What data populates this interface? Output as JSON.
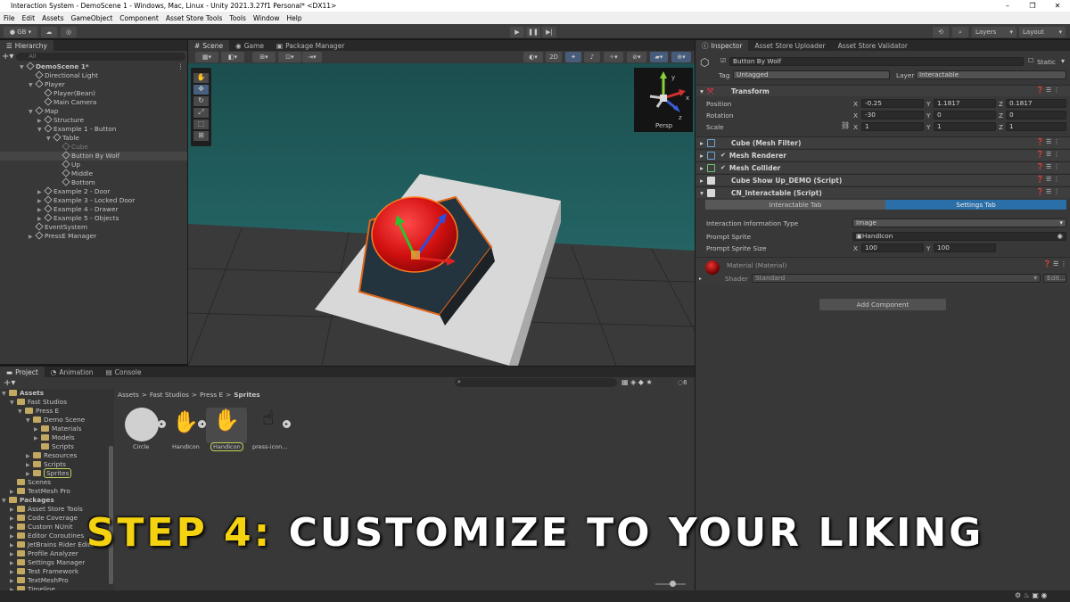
{
  "window": {
    "title": "Interaction System - DemoScene 1 - Windows, Mac, Linux - Unity 2021.3.27f1 Personal* <DX11>"
  },
  "menu": [
    "File",
    "Edit",
    "Assets",
    "GameObject",
    "Component",
    "Asset Store Tools",
    "Tools",
    "Window",
    "Help"
  ],
  "toolbar": {
    "account": "GB",
    "layers": "Layers",
    "layout": "Layout"
  },
  "hierarchy": {
    "tab": "Hierarchy",
    "search_placeholder": "All",
    "items": [
      {
        "label": "DemoScene 1*",
        "depth": 0
      },
      {
        "label": "Directional Light",
        "depth": 1
      },
      {
        "label": "Player",
        "depth": 1
      },
      {
        "label": "Player(Bean)",
        "depth": 2
      },
      {
        "label": "Main Camera",
        "depth": 2
      },
      {
        "label": "Map",
        "depth": 1
      },
      {
        "label": "Structure",
        "depth": 2
      },
      {
        "label": "Example 1 - Button",
        "depth": 2
      },
      {
        "label": "Table",
        "depth": 3
      },
      {
        "label": "Cube",
        "depth": 4
      },
      {
        "label": "Button By Wolf",
        "depth": 4
      },
      {
        "label": "Up",
        "depth": 4
      },
      {
        "label": "Middle",
        "depth": 4
      },
      {
        "label": "Bottom",
        "depth": 4
      },
      {
        "label": "Example 2 - Door",
        "depth": 2
      },
      {
        "label": "Example 3 - Locked Door",
        "depth": 2
      },
      {
        "label": "Example 4 - Drawer",
        "depth": 2
      },
      {
        "label": "Example 5 - Objects",
        "depth": 2
      },
      {
        "label": "EventSystem",
        "depth": 1
      },
      {
        "label": "PressE Manager",
        "depth": 1
      }
    ]
  },
  "scene_tabs": [
    "Scene",
    "Game",
    "Package Manager"
  ],
  "scene": {
    "mode_2d": "2D",
    "gizmo_label": "Persp",
    "gizmo_x": "x",
    "gizmo_y": "y",
    "gizmo_z": "z"
  },
  "inspector": {
    "tabs": [
      "Inspector",
      "Asset Store Uploader",
      "Asset Store Validator"
    ],
    "object_name": "Button By Wolf",
    "static_label": "Static",
    "tag_label": "Tag",
    "tag_value": "Untagged",
    "layer_label": "Layer",
    "layer_value": "Interactable",
    "transform": {
      "title": "Transform",
      "position": {
        "label": "Position",
        "x": "-0.25",
        "y": "1.1817",
        "z": "0.1817"
      },
      "rotation": {
        "label": "Rotation",
        "x": "-30",
        "y": "0",
        "z": "0"
      },
      "scale": {
        "label": "Scale",
        "x": "1",
        "y": "1",
        "z": "1"
      },
      "axis_x": "X",
      "axis_y": "Y",
      "axis_z": "Z"
    },
    "components": [
      "Cube (Mesh Filter)",
      "Mesh Renderer",
      "Mesh Collider",
      "Cube Show Up_DEMO (Script)",
      "CN_Interactable (Script)"
    ],
    "interactable": {
      "tab_left": "Interactable Tab",
      "tab_right": "Settings Tab",
      "info_type_label": "Interaction Information Type",
      "info_type_value": "Image",
      "sprite_label": "Prompt Sprite",
      "sprite_value": "HandIcon",
      "size_label": "Prompt Sprite Size",
      "size_x": "100",
      "size_y": "100"
    },
    "material": {
      "title": "Material (Material)",
      "shader_label": "Shader",
      "shader_value": "Standard",
      "edit_label": "Edit..."
    },
    "add_component": "Add Component"
  },
  "project": {
    "tabs": [
      "Project",
      "Animation",
      "Console"
    ],
    "tree": [
      {
        "label": "Assets",
        "depth": 0,
        "bold": true
      },
      {
        "label": "Fast Studios",
        "depth": 1
      },
      {
        "label": "Press E",
        "depth": 2
      },
      {
        "label": "Demo Scene",
        "depth": 3
      },
      {
        "label": "Materials",
        "depth": 4
      },
      {
        "label": "Models",
        "depth": 4
      },
      {
        "label": "Scripts",
        "depth": 4
      },
      {
        "label": "Resources",
        "depth": 3
      },
      {
        "label": "Scripts",
        "depth": 3
      },
      {
        "label": "Sprites",
        "depth": 3
      },
      {
        "label": "Scenes",
        "depth": 1
      },
      {
        "label": "TextMesh Pro",
        "depth": 1
      },
      {
        "label": "Packages",
        "depth": 0,
        "bold": true
      },
      {
        "label": "Asset Store Tools",
        "depth": 1
      },
      {
        "label": "Code Coverage",
        "depth": 1
      },
      {
        "label": "Custom NUnit",
        "depth": 1
      },
      {
        "label": "Editor Coroutines",
        "depth": 1
      },
      {
        "label": "JetBrains Rider Editor",
        "depth": 1
      },
      {
        "label": "Profile Analyzer",
        "depth": 1
      },
      {
        "label": "Settings Manager",
        "depth": 1
      },
      {
        "label": "Test Framework",
        "depth": 1
      },
      {
        "label": "TextMeshPro",
        "depth": 1
      },
      {
        "label": "Timeline",
        "depth": 1
      }
    ],
    "breadcrumb": [
      "Assets",
      "Fast Studios",
      "Press E",
      "Sprites"
    ],
    "hidden_count": "6",
    "assets": [
      "Circle",
      "HandIcon",
      "HandIcon",
      "press-icon..."
    ]
  },
  "overlay": {
    "highlight": "STEP 4:",
    "text": "CUSTOMIZE TO YOUR LIKING"
  }
}
